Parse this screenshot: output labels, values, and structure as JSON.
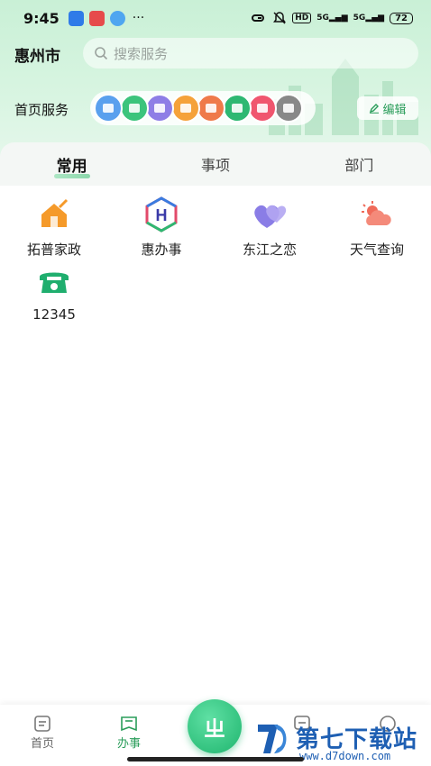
{
  "status_bar": {
    "time": "9:45",
    "dots": "···",
    "hd": "HD",
    "signal1": "5G",
    "signal2": "5G",
    "battery": "72"
  },
  "header": {
    "city": "惠州市",
    "search_placeholder": "搜索服务"
  },
  "home_services": {
    "label": "首页服务",
    "edit_label": "编辑",
    "icons": [
      {
        "name": "service-icon-1",
        "color": "#5aa0ee"
      },
      {
        "name": "service-icon-2",
        "color": "#3cc47c"
      },
      {
        "name": "service-icon-3",
        "color": "#8e7ee6"
      },
      {
        "name": "service-icon-4",
        "color": "#f5a23a"
      },
      {
        "name": "service-icon-5",
        "color": "#ef7a4a"
      },
      {
        "name": "service-icon-6",
        "color": "#2eb872"
      },
      {
        "name": "service-icon-7",
        "color": "#f0566f"
      },
      {
        "name": "service-icon-8",
        "color": "#888888"
      }
    ]
  },
  "tabs": [
    {
      "label": "常用",
      "active": true
    },
    {
      "label": "事项",
      "active": false
    },
    {
      "label": "部门",
      "active": false
    }
  ],
  "grid": [
    {
      "label": "拓普家政",
      "icon": "house-broom-icon",
      "color": "#f59a2a"
    },
    {
      "label": "惠办事",
      "icon": "h-logo-icon",
      "color": "#3a3aa8"
    },
    {
      "label": "东江之恋",
      "icon": "hearts-icon",
      "color": "#8a7de6"
    },
    {
      "label": "天气查询",
      "icon": "weather-icon",
      "color": "#f06b5a"
    },
    {
      "label": "12345",
      "icon": "phone-icon",
      "color": "#1fae6e"
    }
  ],
  "bottom_nav": {
    "home": "首页",
    "affairs": "办事",
    "center_glyph": "ㄓ"
  },
  "watermark": {
    "title": "第七下载站",
    "url": "www.d7down.com"
  },
  "colors": {
    "accent": "#2a9d5a",
    "hero_bg": "#c9f0d6"
  }
}
